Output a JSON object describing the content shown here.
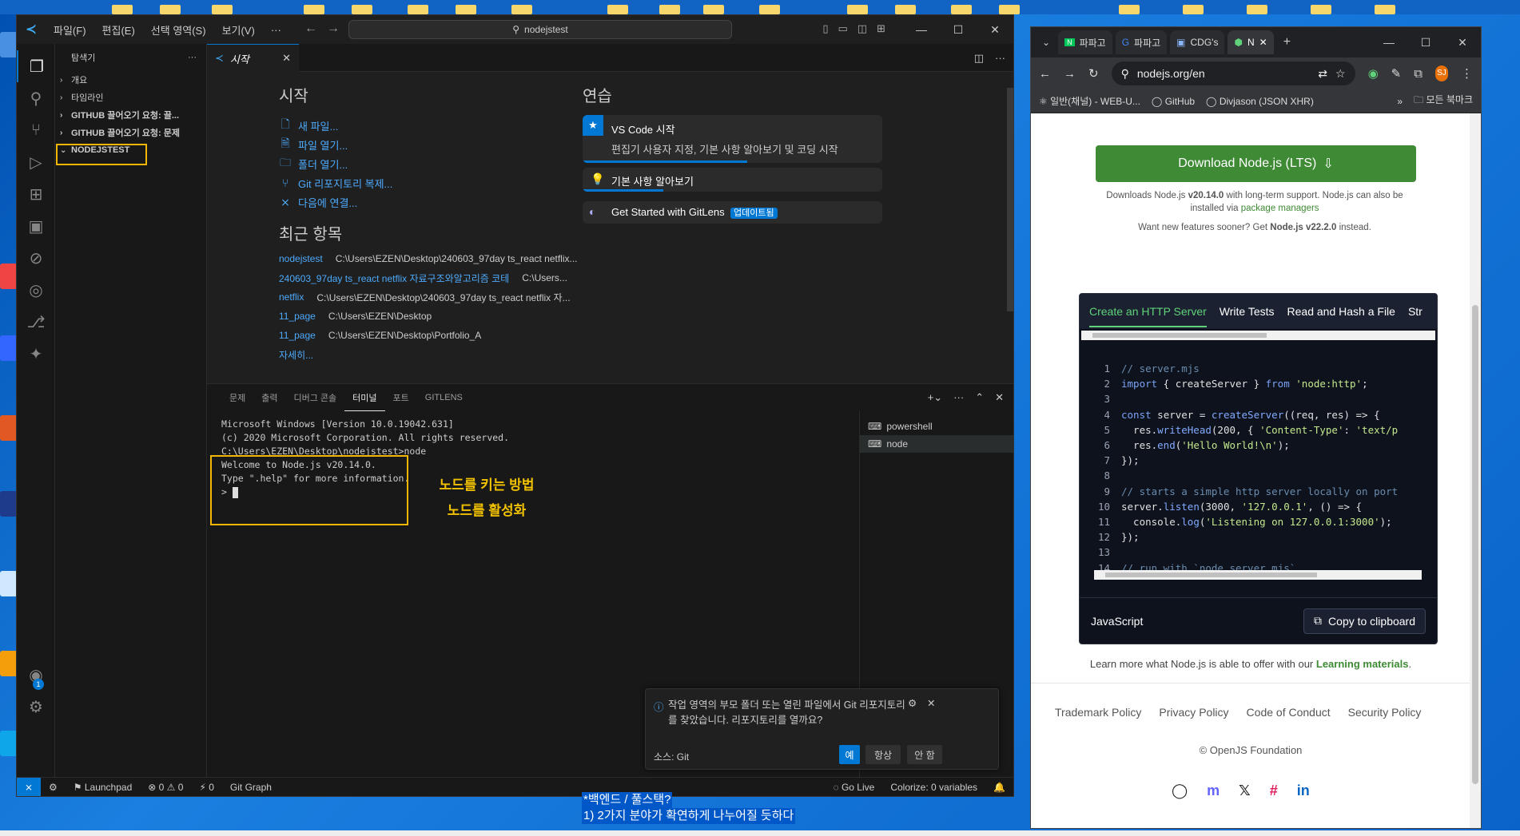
{
  "vscode": {
    "menu": [
      "파일(F)",
      "편집(E)",
      "선택 영역(S)",
      "보기(V)",
      "···"
    ],
    "search": "nodejstest",
    "explorer_title": "탐색기",
    "sidebar_items": [
      "개요",
      "타임라인",
      "GITHUB 끌어오기 요청: 끌...",
      "GITHUB 끌어오기 요청: 문제"
    ],
    "folder": "NODEJSTEST",
    "tab": "시작",
    "start": {
      "heading": "시작",
      "links": [
        "새 파일...",
        "파일 열기...",
        "폴더 열기...",
        "Git 리포지토리 복제...",
        "다음에 연결..."
      ]
    },
    "recent": {
      "heading": "최근 항목",
      "items": [
        {
          "name": "nodejstest",
          "path": "C:\\Users\\EZEN\\Desktop\\240603_97day ts_react netflix..."
        },
        {
          "name": "240603_97day ts_react netflix 자료구조와알고리즘 코테",
          "path": "C:\\Users..."
        },
        {
          "name": "netflix",
          "path": "C:\\Users\\EZEN\\Desktop\\240603_97day ts_react netflix 자..."
        },
        {
          "name": "11_page",
          "path": "C:\\Users\\EZEN\\Desktop"
        },
        {
          "name": "11_page",
          "path": "C:\\Users\\EZEN\\Desktop\\Portfolio_A"
        }
      ],
      "more": "자세히..."
    },
    "walkthroughs": {
      "heading": "연습",
      "card1_title": "VS Code 시작",
      "card1_sub": "편집기 사용자 지정, 기본 사항 알아보기 및 코딩 시작",
      "card2_title": "기본 사항 알아보기",
      "card3_title": "Get Started with GitLens",
      "card3_badge": "업데이트됨"
    },
    "panel_tabs": [
      "문제",
      "출력",
      "디버그 콘솔",
      "터미널",
      "포트",
      "GITLENS"
    ],
    "terminal_lines": [
      "Microsoft Windows [Version 10.0.19042.631]",
      "(c) 2020 Microsoft Corporation. All rights reserved.",
      "",
      "C:\\Users\\EZEN\\Desktop\\nodejstest>node",
      "Welcome to Node.js v20.14.0.",
      "Type \".help\" for more information."
    ],
    "terminal_prompt": ">",
    "terminals": [
      "powershell",
      "node"
    ],
    "annotation": [
      "노드를 키는 방법",
      "노드를 활성화"
    ],
    "notification": {
      "text": "작업 영역의 부모 폴더 또는 열린 파일에서 Git 리포지토리를 찾았습니다. 리포지토리를 열까요?",
      "source": "소스: Git",
      "buttons": [
        "예",
        "항상",
        "안 함"
      ]
    },
    "status": {
      "launchpad": "Launchpad",
      "problems": "0",
      "warnings": "0",
      "ports": "0",
      "git_graph": "Git Graph",
      "go_live": "Go Live",
      "colorize": "Colorize: 0 variables",
      "account_badge": "1"
    }
  },
  "chrome": {
    "tabs": [
      "파파고",
      "파파고",
      "CDG's",
      "N"
    ],
    "url": "nodejs.org/en",
    "profile": "SJ",
    "bookmarks": [
      "일반(채널) - WEB-U...",
      "GitHub",
      "Divjason (JSON XHR)"
    ],
    "bookmarks_folder": "모든 북마크",
    "download_label": "Download Node.js (LTS)",
    "download_note_prefix": "Downloads Node.js ",
    "download_version": "v20.14.0",
    "download_note_mid": " with long-term support. Node.js can also be installed via ",
    "download_note_link": "package managers",
    "newer_prefix": "Want new features sooner? Get ",
    "newer_version": "Node.js v22.2.0",
    "newer_suffix": " instead.",
    "code_tabs": [
      "Create an HTTP Server",
      "Write Tests",
      "Read and Hash a File",
      "Str"
    ],
    "code_lang": "JavaScript",
    "copy_label": "Copy to clipboard",
    "learn_prefix": "Learn more what Node.js is able to offer with our ",
    "learn_link": "Learning materials",
    "footer_links": [
      "Trademark Policy",
      "Privacy Policy",
      "Code of Conduct",
      "Security Policy"
    ],
    "copyright": "© OpenJS Foundation"
  },
  "desktop_note": [
    "*백엔드 / 풀스택?",
    "1) 2가지 분야가 확연하게 나누어질 듯하다"
  ],
  "colors": {
    "accent": "#0078d4",
    "node_green": "#3e8a35",
    "highlight": "#f2b705"
  }
}
